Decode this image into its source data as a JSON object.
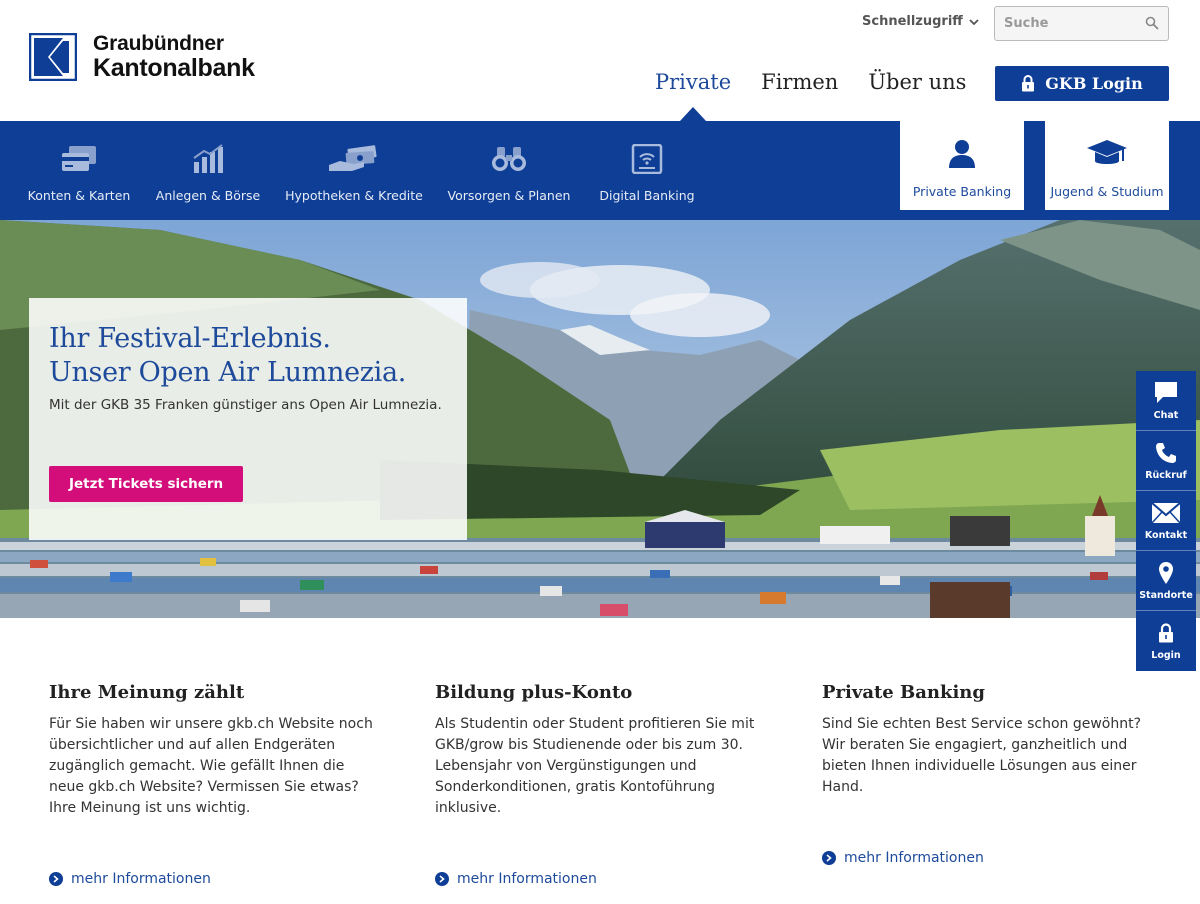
{
  "header": {
    "logo_line1": "Graubündner",
    "logo_line2": "Kantonalbank",
    "quick_access": "Schnellzugriff",
    "search_placeholder": "Suche",
    "nav": [
      "Private",
      "Firmen",
      "Über uns"
    ],
    "login_label": "GKB Login"
  },
  "subnav": {
    "items": [
      {
        "label": "Konten & Karten",
        "icon": "credit-cards-icon"
      },
      {
        "label": "Anlegen & Börse",
        "icon": "bar-chart-icon"
      },
      {
        "label": "Hypotheken & Kredite",
        "icon": "money-hand-icon"
      },
      {
        "label": "Vorsorgen & Planen",
        "icon": "binoculars-icon"
      },
      {
        "label": "Digital Banking",
        "icon": "tablet-wifi-icon"
      }
    ],
    "tiles": [
      {
        "label": "Private Banking",
        "icon": "person-icon"
      },
      {
        "label": "Jugend & Studium",
        "icon": "graduation-cap-icon"
      }
    ]
  },
  "hero": {
    "title_line1": "Ihr Festival-Erlebnis.",
    "title_line2": "Unser Open Air Lumnezia.",
    "text": "Mit der GKB 35 Franken günstiger ans Open Air Lumnezia.",
    "button": "Jetzt Tickets sichern"
  },
  "sidebar": {
    "items": [
      {
        "label": "Chat",
        "icon": "chat-bubble-icon"
      },
      {
        "label": "Rückruf",
        "icon": "phone-icon"
      },
      {
        "label": "Kontakt",
        "icon": "envelope-icon"
      },
      {
        "label": "Standorte",
        "icon": "map-pin-icon"
      },
      {
        "label": "Login",
        "icon": "lock-icon"
      }
    ]
  },
  "teasers": [
    {
      "title": "Ihre Meinung zählt",
      "text": "Für Sie haben wir unsere gkb.ch Website noch übersichtlicher und auf allen Endgeräten zugänglich gemacht. Wie gefällt Ihnen die neue gkb.ch Website? Vermissen Sie etwas? Ihre Meinung ist uns wichtig.",
      "link": "mehr Informationen"
    },
    {
      "title": "Bildung plus-Konto",
      "text": "Als Studentin oder Student profitieren Sie mit GKB/grow bis Studienende oder bis zum 30. Lebensjahr von Vergünstigungen und Sonderkonditionen, gratis Kontoführung inklusive.",
      "link": "mehr Informationen"
    },
    {
      "title": "Private Banking",
      "text": "Sind Sie echten Best Service schon gewöhnt? Wir beraten Sie engagiert, ganzheitlich und bieten Ihnen individuelle Lösungen aus einer Hand.",
      "link": "mehr Informationen"
    }
  ],
  "colors": {
    "brand_blue": "#0f3e96",
    "link_blue": "#1e4a9b",
    "cta_magenta": "#d30e7b"
  }
}
